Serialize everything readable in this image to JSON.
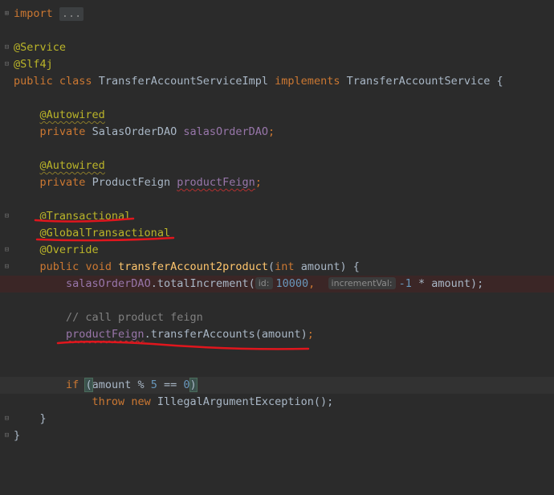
{
  "editor": {
    "lines": {
      "l1_import": "import",
      "l1_folded": "...",
      "l3_service": "@Service",
      "l4_slf4j": "@Slf4j",
      "l5_public": "public",
      "l5_class": "class",
      "l5_name": "TransferAccountServiceImpl",
      "l5_implements": "implements",
      "l5_iface": "TransferAccountService",
      "l5_brace": "{",
      "l7_autowired": "@Autowired",
      "l8_private": "private",
      "l8_type": "SalasOrderDAO",
      "l8_field": "salasOrderDAO",
      "l8_semi": ";",
      "l10_autowired": "@Autowired",
      "l11_private": "private",
      "l11_type": "ProductFeign",
      "l11_field": "productFeign",
      "l11_semi": ";",
      "l13_transactional": "@Transactional",
      "l14_global": "@GlobalTransactional",
      "l15_override": "@Override",
      "l16_public": "public",
      "l16_void": "void",
      "l16_method": "transferAccount2product",
      "l16_open": "(",
      "l16_int": "int",
      "l16_param": "amount",
      "l16_close": ") {",
      "l17_field": "salasOrderDAO",
      "l17_call": ".totalIncrement(",
      "l17_hint_id": "id:",
      "l17_num1": "10000",
      "l17_comma": ",",
      "l17_hint_inc": "incrementVal:",
      "l17_num2": "-1",
      "l17_rest": " * amount);",
      "l19_comment": "// call product feign",
      "l20_field": "productFeign",
      "l20_call": ".transferAccounts(amount)",
      "l20_semi": ";",
      "l23_if": "if",
      "l23_open": "(",
      "l23_mid": "amount % ",
      "l23_five": "5",
      "l23_eq": " == ",
      "l23_zero": "0",
      "l23_close": ")",
      "l24_throw": "throw",
      "l24_new": "new",
      "l24_rest": "IllegalArgumentException();",
      "l25_brace": "}",
      "l26_brace": "}"
    }
  }
}
